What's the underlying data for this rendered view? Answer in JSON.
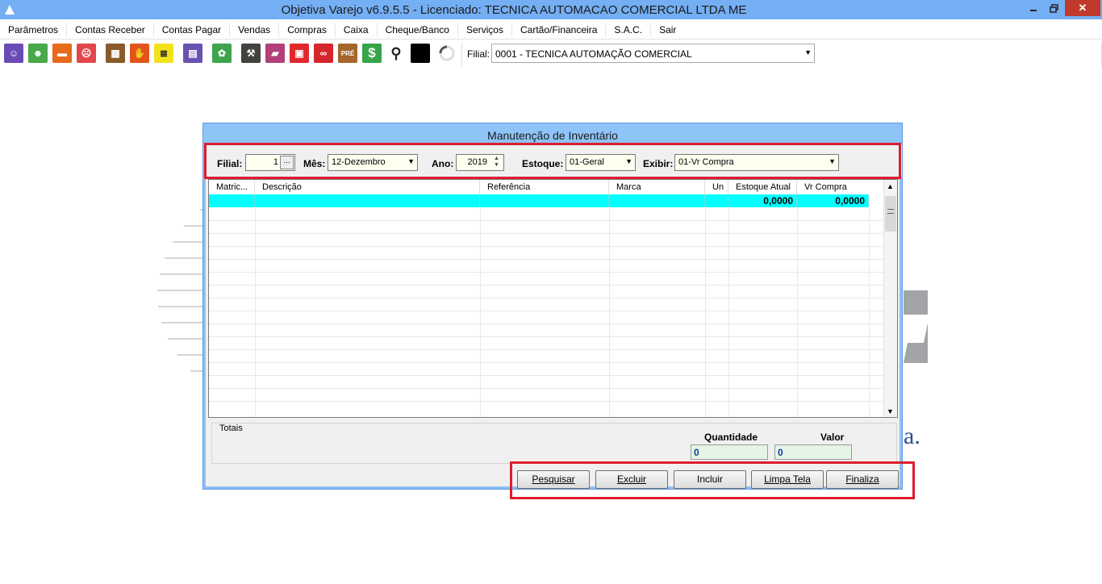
{
  "window": {
    "title": "Objetiva Varejo v6.9.5.5 - Licenciado: TECNICA AUTOMACAO COMERCIAL LTDA ME",
    "close": "✕"
  },
  "menu": [
    "Parâmetros",
    "Contas Receber",
    "Contas Pagar",
    "Vendas",
    "Compras",
    "Caixa",
    "Cheque/Banco",
    "Serviços",
    "Cartão/Financeira",
    "S.A.C.",
    "Sair"
  ],
  "toolbar": {
    "branch_label": "Filial:",
    "branch_value": "0001 - TECNICA AUTOMAÇÃO COMERCIAL"
  },
  "background": {
    "tagline": "a."
  },
  "dialog": {
    "title": "Manutenção de Inventário",
    "filters": {
      "filial_label": "Filial:",
      "filial_value": "1",
      "filial_button": "...",
      "mes_label": "Mês:",
      "mes_value": "12-Dezembro",
      "ano_label": "Ano:",
      "ano_value": "2019",
      "estoque_label": "Estoque:",
      "estoque_value": "01-Geral",
      "exibir_label": "Exibir:",
      "exibir_value": "01-Vr Compra"
    },
    "grid": {
      "columns": [
        "Matric...",
        "Descrição",
        "Referência",
        "Marca",
        "Un",
        "Estoque Atual",
        "Vr Compra"
      ],
      "rows": [
        [
          "",
          "",
          "",
          "",
          "",
          "0,0000",
          "0,0000"
        ]
      ]
    },
    "totals": {
      "label": "Totais",
      "quantidade_label": "Quantidade",
      "valor_label": "Valor",
      "quantidade_value": "0",
      "valor_value": "0"
    },
    "actions": [
      "Pesquisar",
      "Excluir",
      "Incluir",
      "Limpa Tela",
      "Finaliza"
    ]
  }
}
